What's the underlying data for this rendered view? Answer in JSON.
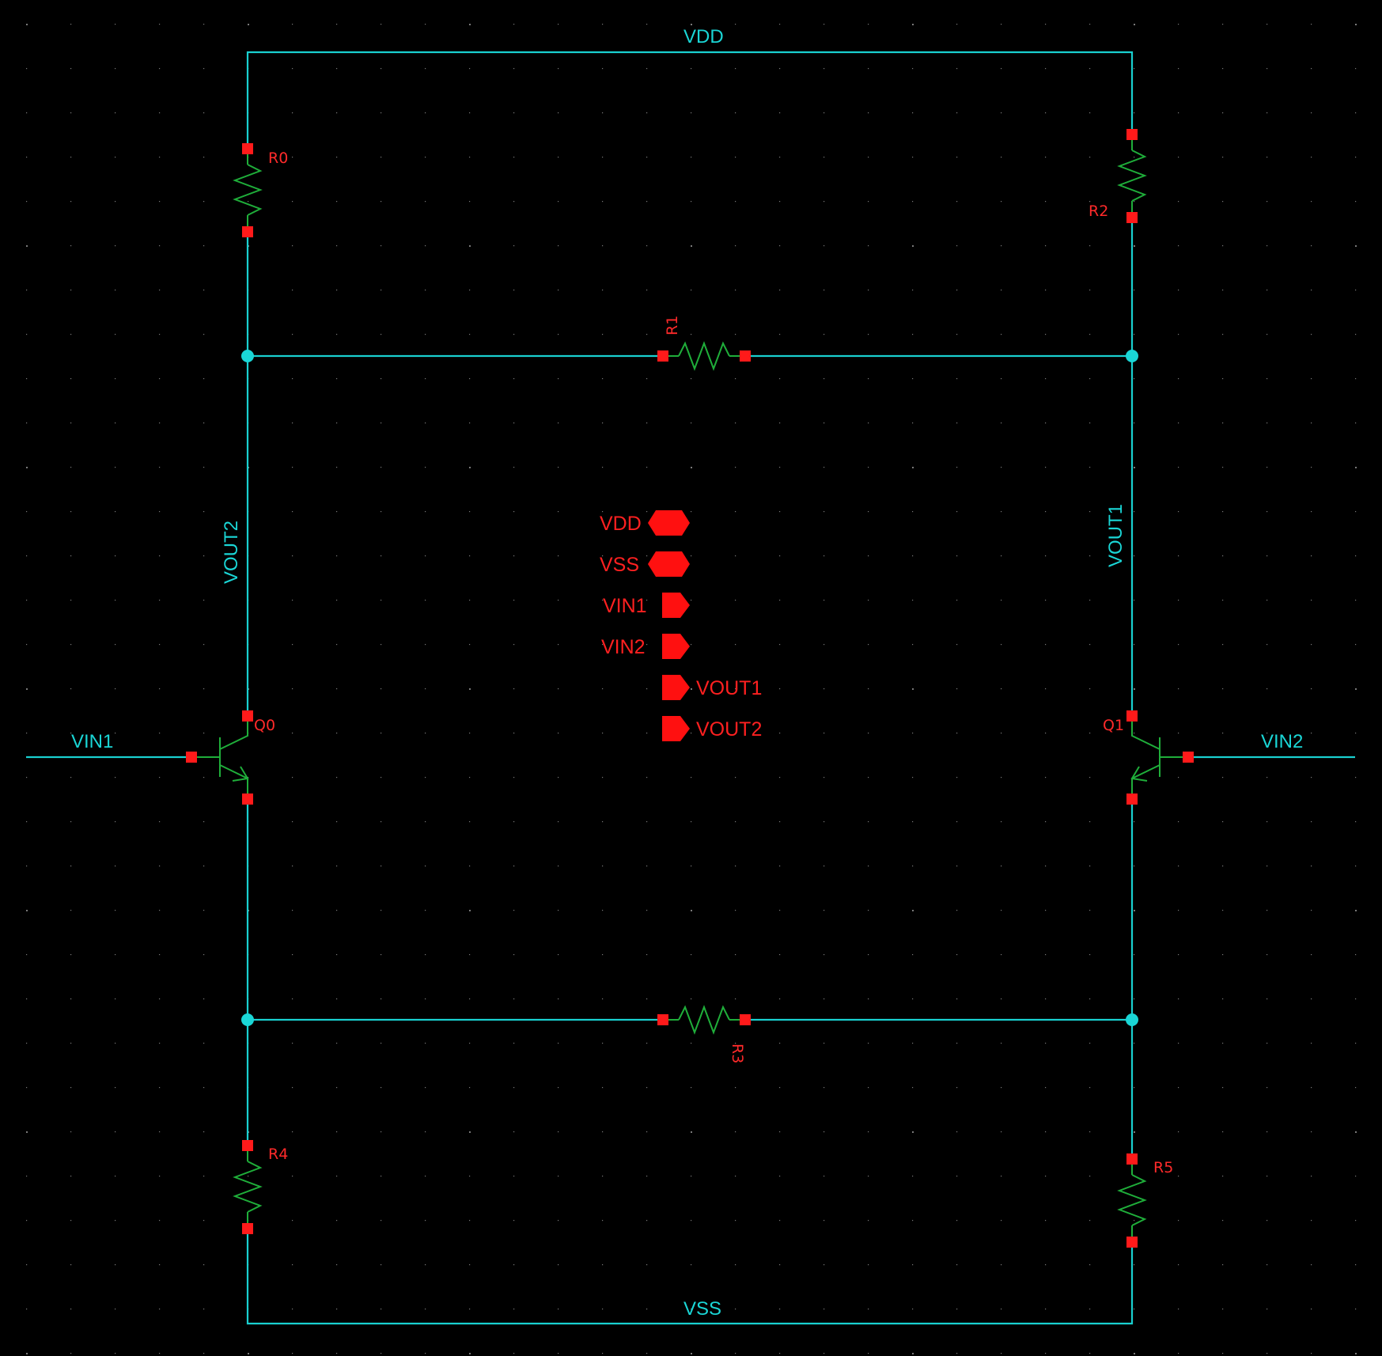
{
  "nets": {
    "top": "VDD",
    "bottom": "VSS",
    "left_vertical": "VOUT2",
    "right_vertical": "VOUT1",
    "left_input": "VIN1",
    "right_input": "VIN2"
  },
  "instances": {
    "r0": "R0",
    "r1": "R1",
    "r2": "R2",
    "r3": "R3",
    "r4": "R4",
    "r5": "R5",
    "q0": "Q0",
    "q1": "Q1"
  },
  "pins": [
    {
      "name": "VDD",
      "kind": "inout"
    },
    {
      "name": "VSS",
      "kind": "inout"
    },
    {
      "name": "VIN1",
      "kind": "input"
    },
    {
      "name": "VIN2",
      "kind": "input"
    },
    {
      "name": "VOUT1",
      "kind": "output"
    },
    {
      "name": "VOUT2",
      "kind": "output"
    }
  ],
  "colors": {
    "background": "#000000",
    "wire": "#19d0d0",
    "device": "#1fae3a",
    "terminal": "#ff1a1a",
    "label": "#ff2a2a"
  }
}
